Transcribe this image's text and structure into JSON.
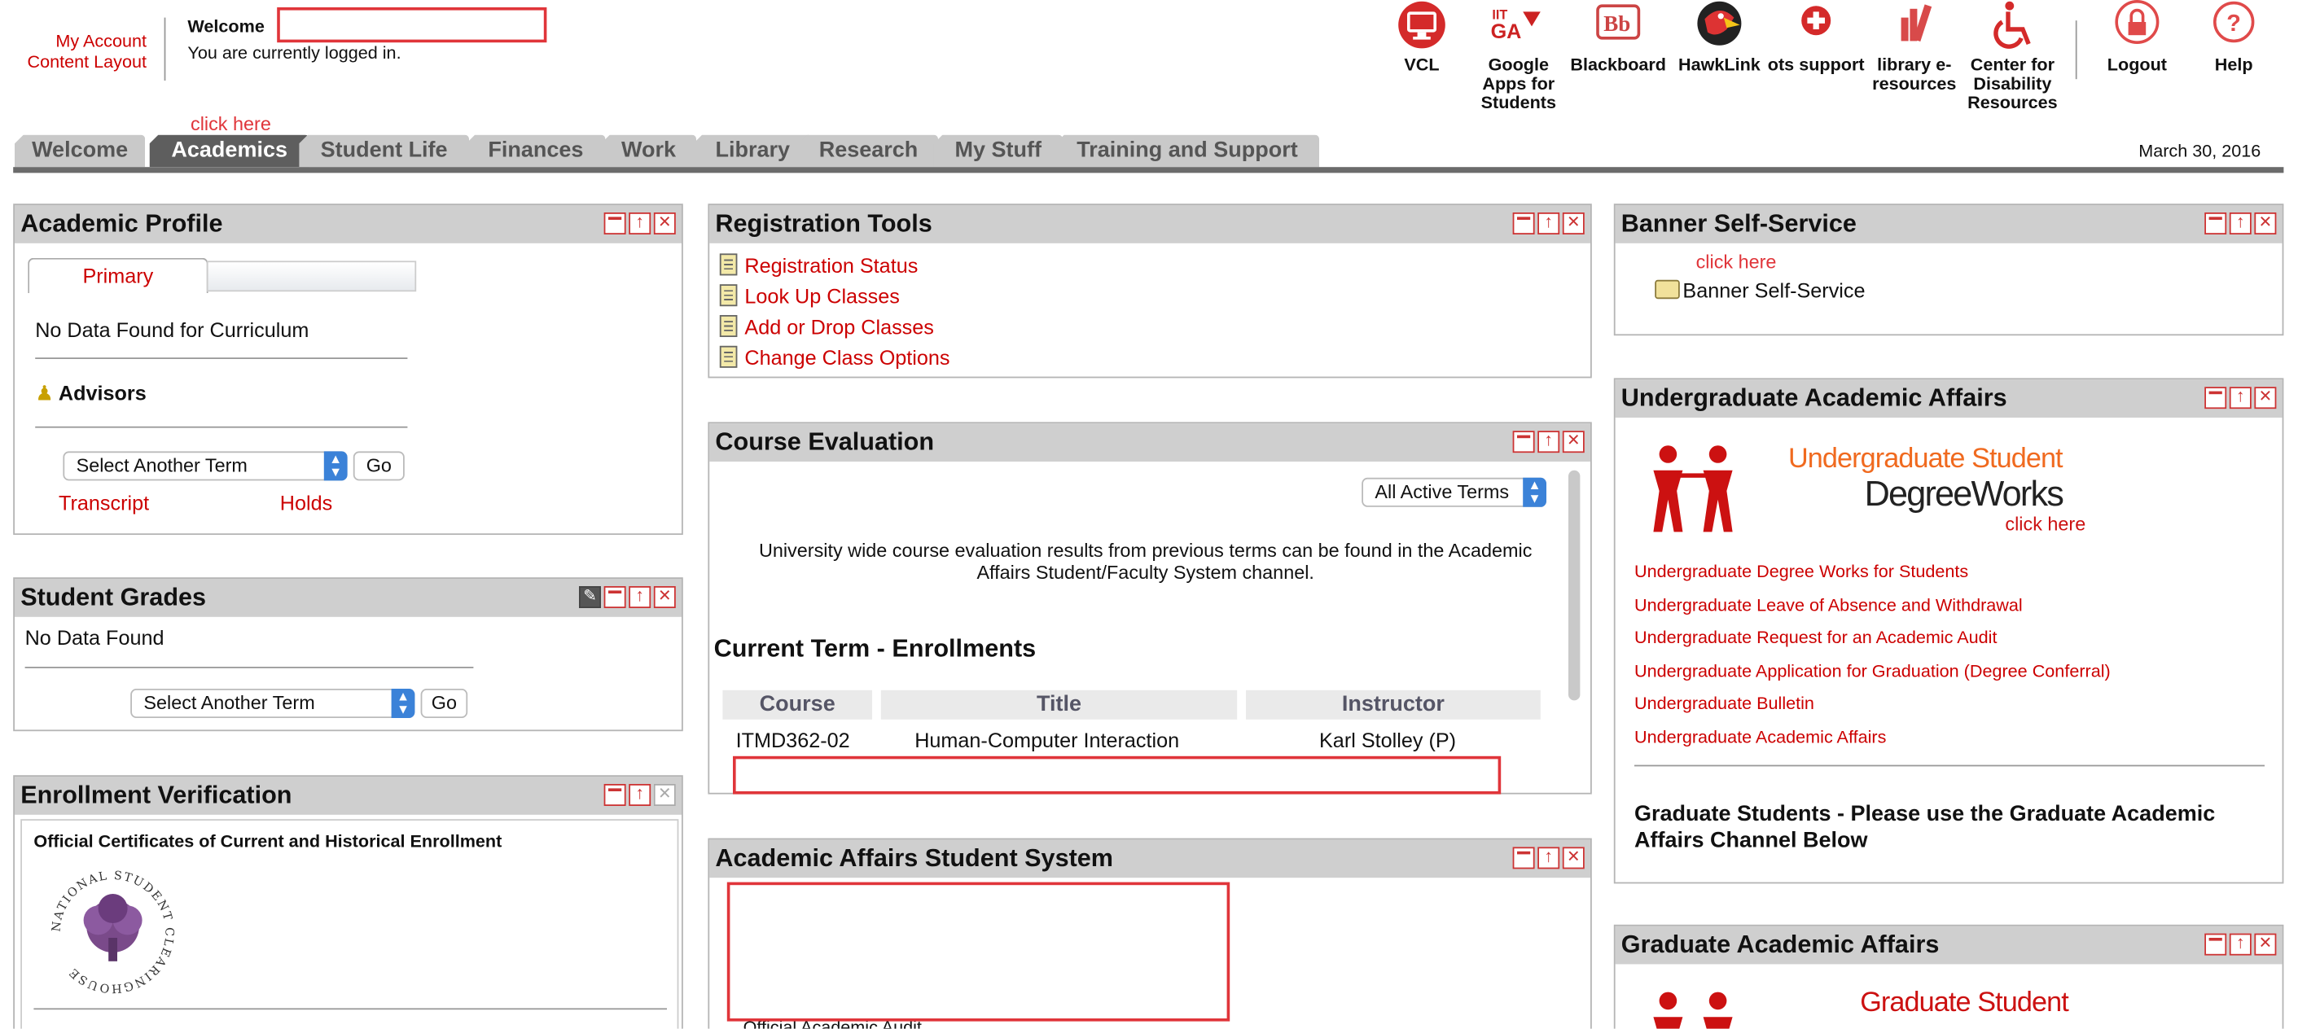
{
  "header": {
    "my_account": "My Account",
    "content_layout": "Content Layout",
    "welcome": "Welcome",
    "logged_in": "You are currently logged in.",
    "click_here": "click here"
  },
  "apps": [
    {
      "label": "VCL",
      "icon": "monitor-icon"
    },
    {
      "label": "Google Apps for Students",
      "icon": "google-apps-icon"
    },
    {
      "label": "Blackboard",
      "icon": "blackboard-icon"
    },
    {
      "label": "HawkLink",
      "icon": "hawk-icon"
    },
    {
      "label": "ots support",
      "icon": "plus-icon"
    },
    {
      "label": "library e-resources",
      "icon": "library-icon"
    },
    {
      "label": "Center for Disability Resources",
      "icon": "wheelchair-icon"
    },
    {
      "label": "Logout",
      "icon": "lock-icon"
    },
    {
      "label": "Help",
      "icon": "help-icon"
    }
  ],
  "tabs": [
    {
      "label": "Welcome",
      "active": false
    },
    {
      "label": "Academics",
      "active": true
    },
    {
      "label": "Student Life",
      "active": false
    },
    {
      "label": "Finances",
      "active": false
    },
    {
      "label": "Work",
      "active": false
    },
    {
      "label": "Library",
      "active": false
    },
    {
      "label": "Research",
      "active": false
    },
    {
      "label": "My Stuff",
      "active": false
    },
    {
      "label": "Training and Support",
      "active": false
    }
  ],
  "date": "March 30, 2016",
  "academic_profile": {
    "title": "Academic Profile",
    "tab_primary": "Primary",
    "no_data": "No Data Found for Curriculum",
    "advisors": "Advisors",
    "select_term": "Select Another Term",
    "go": "Go",
    "transcript": "Transcript",
    "holds": "Holds"
  },
  "student_grades": {
    "title": "Student Grades",
    "no_data": "No Data Found",
    "select_term": "Select Another Term",
    "go": "Go"
  },
  "enrollment_verification": {
    "title": "Enrollment Verification",
    "heading": "Official Certificates of Current and Historical Enrollment",
    "seal_text": "NATIONAL STUDENT CLEARINGHOUSE"
  },
  "registration_tools": {
    "title": "Registration Tools",
    "links": [
      "Registration Status",
      "Look Up Classes",
      "Add or Drop Classes",
      "Change Class Options"
    ]
  },
  "course_evaluation": {
    "title": "Course Evaluation",
    "select": "All Active Terms",
    "info": "University wide course evaluation results from previous terms can be found in the Academic Affairs Student/Faculty System channel.",
    "enrollments_heading": "Current Term - Enrollments",
    "columns": [
      "Course",
      "Title",
      "Instructor"
    ],
    "rows": [
      [
        "ITMD362-02",
        "Human-Computer Interaction",
        "Karl Stolley (P)"
      ]
    ]
  },
  "academic_affairs_system": {
    "title": "Academic Affairs Student System",
    "partial_text": "Official Academic Audit"
  },
  "banner": {
    "title": "Banner Self-Service",
    "click_here": "click here",
    "link": "Banner Self-Service"
  },
  "undergrad": {
    "title": "Undergraduate Academic Affairs",
    "logo_line1": "Undergraduate Student",
    "logo_line2": "DegreeWorks",
    "logo_click": "click here",
    "links": [
      "Undergraduate Degree Works for Students",
      "Undergraduate Leave of Absence and Withdrawal",
      "Undergraduate Request for an Academic Audit",
      "Undergraduate Application for Graduation (Degree Conferral)",
      "Undergraduate Bulletin",
      "Undergraduate Academic Affairs"
    ],
    "grad_note": "Graduate Students - Please use the Graduate Academic Affairs Channel Below"
  },
  "grad": {
    "title": "Graduate Academic Affairs",
    "logo_line1": "Graduate Student"
  },
  "colors": {
    "accent": "#cc0000",
    "tab_active": "#5e5e5e",
    "tab": "#c9c9c9",
    "title_bar": "#cfcfcf",
    "annotation": "#e0353a"
  }
}
